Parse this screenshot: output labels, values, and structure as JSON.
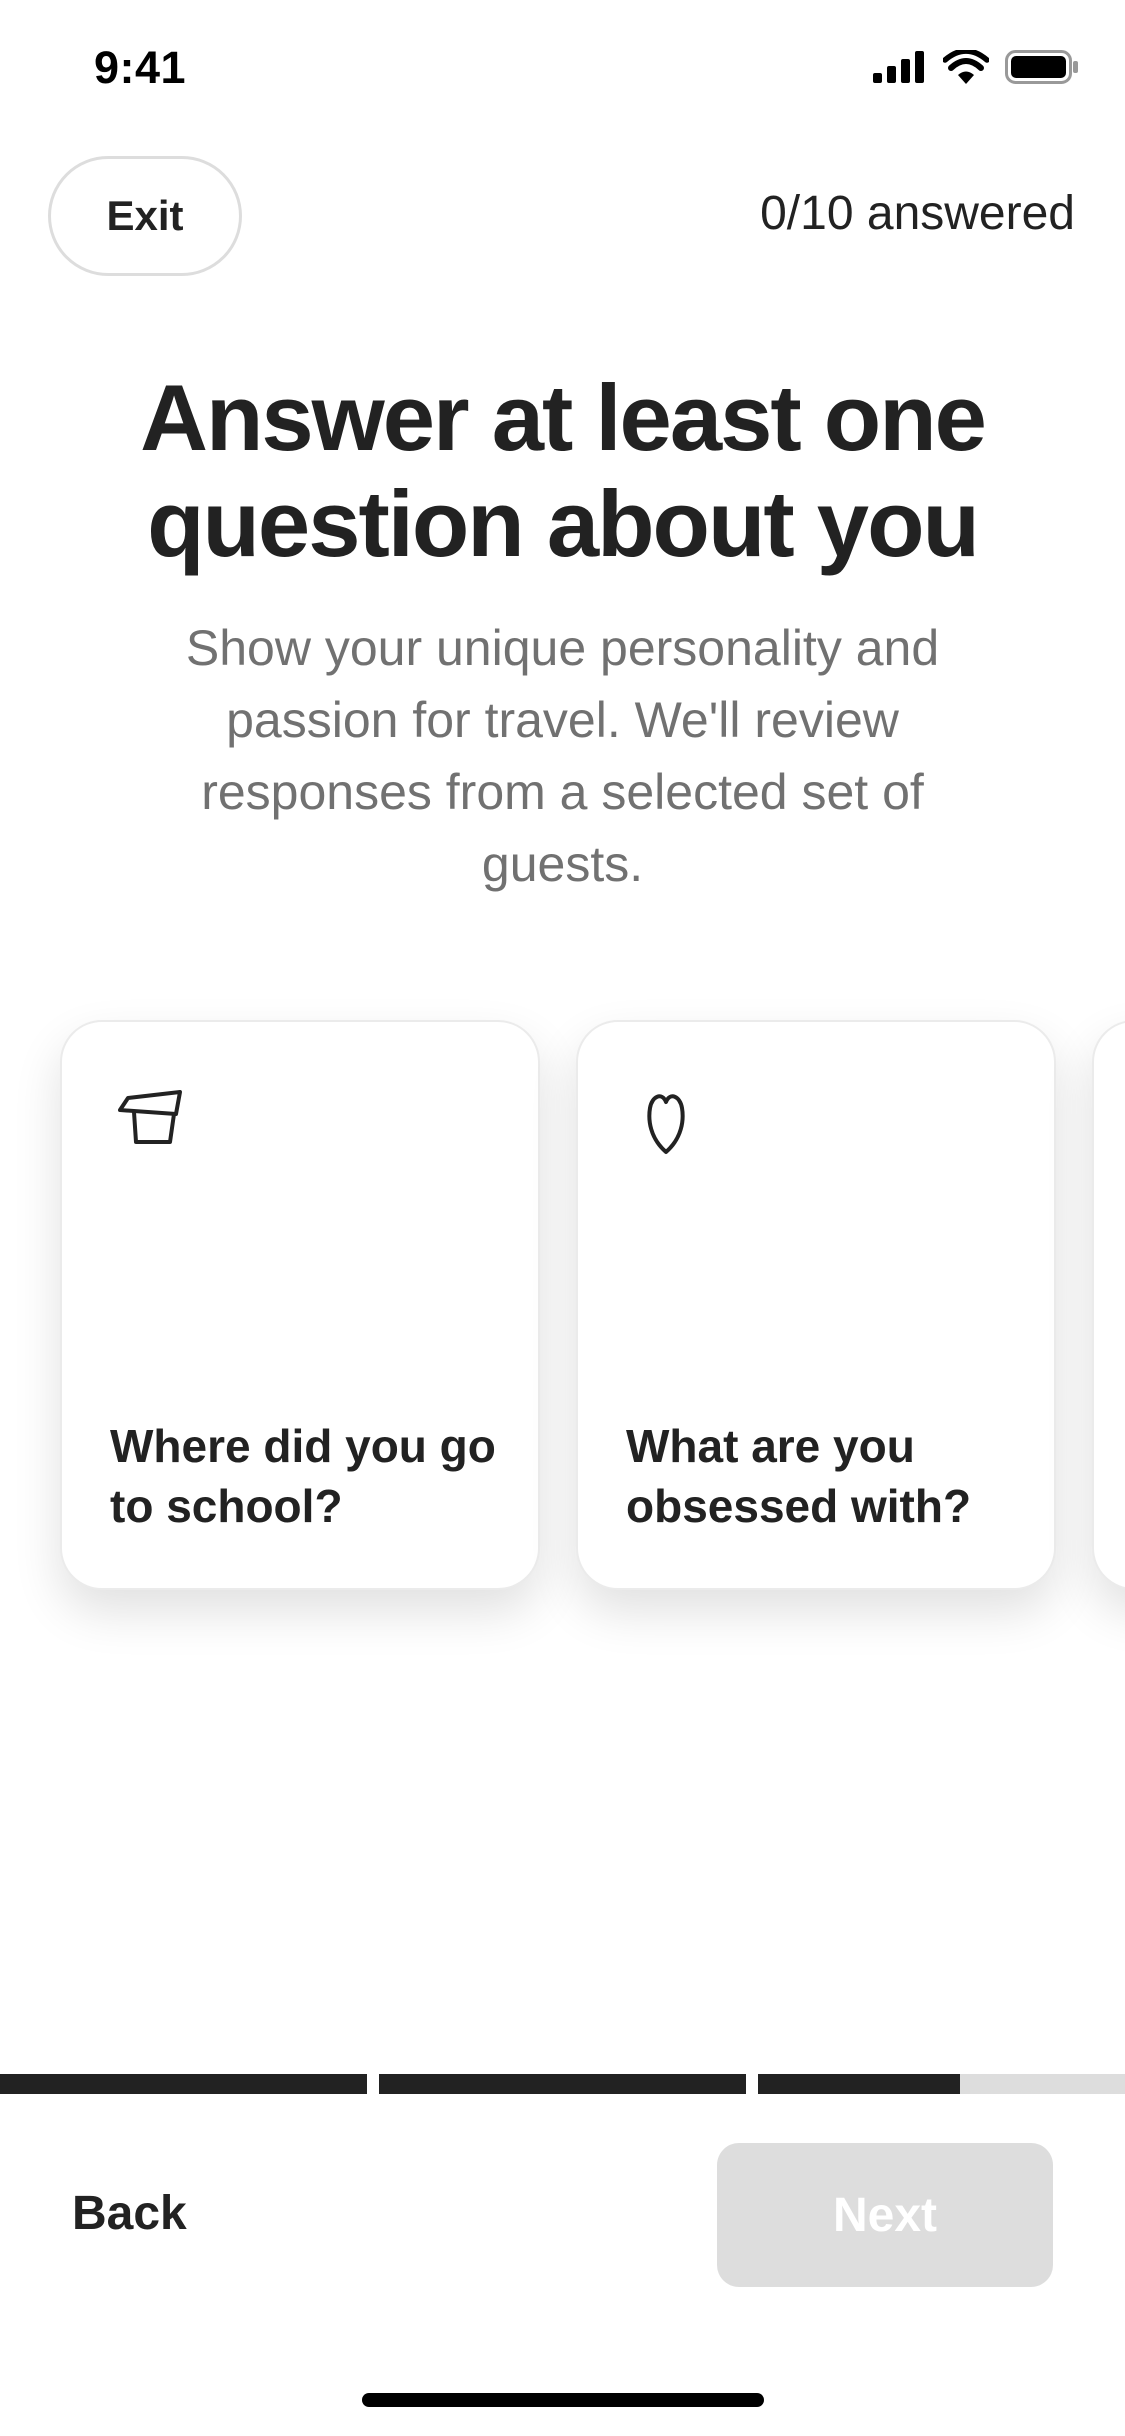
{
  "status_bar": {
    "time": "9:41"
  },
  "top_bar": {
    "exit_label": "Exit",
    "answered_text": "0/10 answered"
  },
  "heading": {
    "title": "Answer at least one question about you",
    "subtitle": "Show your unique personality and passion for travel. We'll review responses from a selected set of guests."
  },
  "cards": [
    {
      "icon": "school-cap-icon",
      "label": "Where did you go to school?"
    },
    {
      "icon": "heart-icon",
      "label": "What are you obsessed with?"
    },
    {
      "icon": "",
      "label": ""
    }
  ],
  "progress": {
    "segments": [
      1,
      1,
      0.55
    ]
  },
  "footer": {
    "back_label": "Back",
    "next_label": "Next"
  },
  "colors": {
    "text": "#222222",
    "muted": "#717171",
    "border": "#dddddd",
    "disabled": "#dddddd"
  }
}
